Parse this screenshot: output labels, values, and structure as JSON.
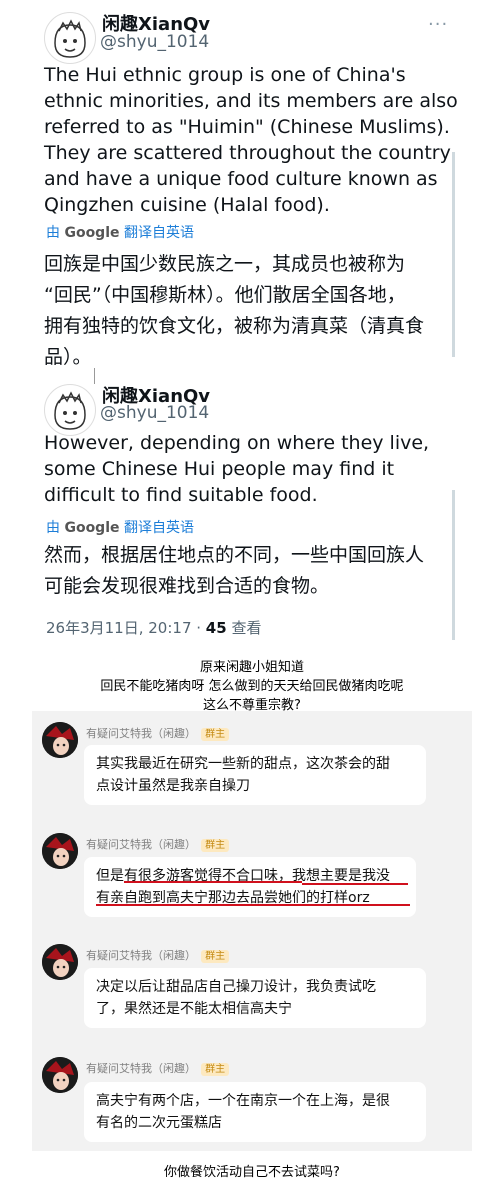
{
  "tweet1": {
    "name": "闲趣XianQv",
    "handle": "@shyu_1014",
    "text_en_lines": [
      "The Hui ethnic group is one of China's",
      "ethnic minorities, and its members are also",
      "referred to as \"Huimin\" (Chinese Muslims).",
      "They are scattered throughout the country",
      "and have a unique food culture known as",
      "Qingzhen cuisine (Halal food)."
    ],
    "translate_prefix": "由",
    "translate_brand": "Google",
    "translate_suffix": "翻译自英语",
    "text_zh_lines": [
      "回族是中国少数民族之一，其成员也被称为",
      "“回民”（中国穆斯林）。他们散居全国各地，",
      "拥有独特的饮食文化，被称为清真菜（清真食",
      "品）。"
    ]
  },
  "tweet2": {
    "name": "闲趣XianQv",
    "handle": "@shyu_1014",
    "text_en_lines": [
      "However, depending on where they live,",
      "some Chinese Hui people may find it",
      "difficult to find suitable food."
    ],
    "translate_prefix": "由",
    "translate_brand": "Google",
    "translate_suffix": "翻译自英语",
    "text_zh_lines": [
      "然而，根据居住地点的不同，一些中国回族人",
      "可能会发现很难找到合适的食物。"
    ],
    "timestamp": "26年3月11日, 20:17 · ",
    "views_count": "45",
    "views_label": " 查看"
  },
  "caption_top_lines": [
    "原来闲趣小姐知道",
    "回民不能吃猪肉呀 怎么做到的天天给回民做猪肉吃呢",
    "这么不尊重宗教?"
  ],
  "chat": {
    "messages": [
      {
        "sender": "有疑问艾特我（闲趣）",
        "badge": "群主",
        "lines": [
          "其实我最近在研究一些新的甜点，这次茶会的甜",
          "点设计虽然是我亲自操刀"
        ]
      },
      {
        "sender": "有疑问艾特我（闲趣）",
        "badge": "群主",
        "lines": [
          "但是有很多游客觉得不合口味，我想主要是我没",
          "有亲自跑到高夫宁那边去品尝她们的打样orz"
        ]
      },
      {
        "sender": "有疑问艾特我（闲趣）",
        "badge": "群主",
        "lines": [
          "决定以后让甜品店自己操刀设计，我负责试吃",
          "了，果然还是不能太相信高夫宁"
        ]
      },
      {
        "sender": "有疑问艾特我（闲趣）",
        "badge": "群主",
        "lines": [
          "高夫宁有两个店，一个在南京一个在上海，是很",
          "有名的二次元蛋糕店"
        ]
      }
    ]
  },
  "caption_bottom": "你做餐饮活动自己不去试菜吗?",
  "colors": {
    "link_blue": "#1d7ed8",
    "underline_red": "#d0101d",
    "badge_text": "#c48a12",
    "badge_bg": "#fde9c0",
    "chat_bg": "#f2f2f2"
  }
}
